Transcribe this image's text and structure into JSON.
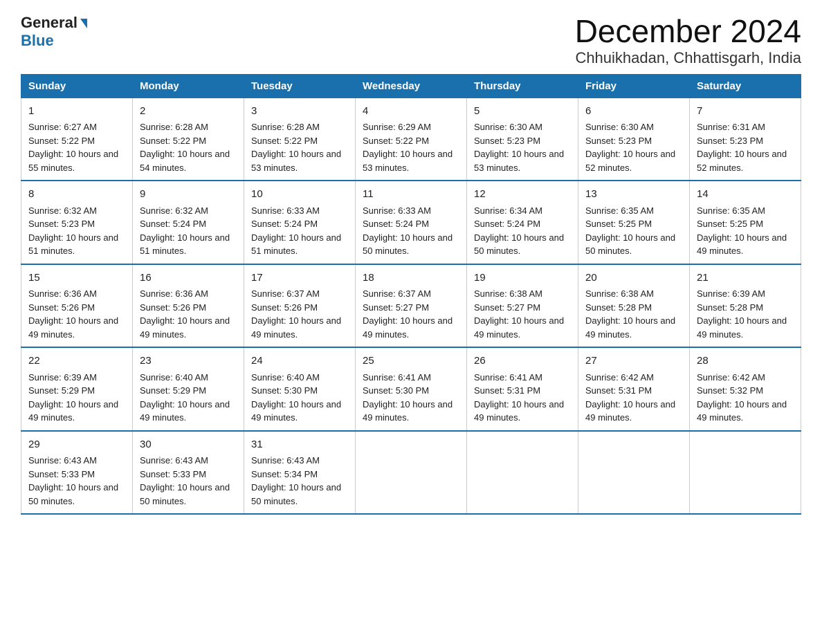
{
  "logo": {
    "general": "General",
    "blue": "Blue"
  },
  "title": "December 2024",
  "subtitle": "Chhuikhadan, Chhattisgarh, India",
  "days_header": [
    "Sunday",
    "Monday",
    "Tuesday",
    "Wednesday",
    "Thursday",
    "Friday",
    "Saturday"
  ],
  "weeks": [
    [
      {
        "day": "1",
        "sunrise": "6:27 AM",
        "sunset": "5:22 PM",
        "daylight": "10 hours and 55 minutes."
      },
      {
        "day": "2",
        "sunrise": "6:28 AM",
        "sunset": "5:22 PM",
        "daylight": "10 hours and 54 minutes."
      },
      {
        "day": "3",
        "sunrise": "6:28 AM",
        "sunset": "5:22 PM",
        "daylight": "10 hours and 53 minutes."
      },
      {
        "day": "4",
        "sunrise": "6:29 AM",
        "sunset": "5:22 PM",
        "daylight": "10 hours and 53 minutes."
      },
      {
        "day": "5",
        "sunrise": "6:30 AM",
        "sunset": "5:23 PM",
        "daylight": "10 hours and 53 minutes."
      },
      {
        "day": "6",
        "sunrise": "6:30 AM",
        "sunset": "5:23 PM",
        "daylight": "10 hours and 52 minutes."
      },
      {
        "day": "7",
        "sunrise": "6:31 AM",
        "sunset": "5:23 PM",
        "daylight": "10 hours and 52 minutes."
      }
    ],
    [
      {
        "day": "8",
        "sunrise": "6:32 AM",
        "sunset": "5:23 PM",
        "daylight": "10 hours and 51 minutes."
      },
      {
        "day": "9",
        "sunrise": "6:32 AM",
        "sunset": "5:24 PM",
        "daylight": "10 hours and 51 minutes."
      },
      {
        "day": "10",
        "sunrise": "6:33 AM",
        "sunset": "5:24 PM",
        "daylight": "10 hours and 51 minutes."
      },
      {
        "day": "11",
        "sunrise": "6:33 AM",
        "sunset": "5:24 PM",
        "daylight": "10 hours and 50 minutes."
      },
      {
        "day": "12",
        "sunrise": "6:34 AM",
        "sunset": "5:24 PM",
        "daylight": "10 hours and 50 minutes."
      },
      {
        "day": "13",
        "sunrise": "6:35 AM",
        "sunset": "5:25 PM",
        "daylight": "10 hours and 50 minutes."
      },
      {
        "day": "14",
        "sunrise": "6:35 AM",
        "sunset": "5:25 PM",
        "daylight": "10 hours and 49 minutes."
      }
    ],
    [
      {
        "day": "15",
        "sunrise": "6:36 AM",
        "sunset": "5:26 PM",
        "daylight": "10 hours and 49 minutes."
      },
      {
        "day": "16",
        "sunrise": "6:36 AM",
        "sunset": "5:26 PM",
        "daylight": "10 hours and 49 minutes."
      },
      {
        "day": "17",
        "sunrise": "6:37 AM",
        "sunset": "5:26 PM",
        "daylight": "10 hours and 49 minutes."
      },
      {
        "day": "18",
        "sunrise": "6:37 AM",
        "sunset": "5:27 PM",
        "daylight": "10 hours and 49 minutes."
      },
      {
        "day": "19",
        "sunrise": "6:38 AM",
        "sunset": "5:27 PM",
        "daylight": "10 hours and 49 minutes."
      },
      {
        "day": "20",
        "sunrise": "6:38 AM",
        "sunset": "5:28 PM",
        "daylight": "10 hours and 49 minutes."
      },
      {
        "day": "21",
        "sunrise": "6:39 AM",
        "sunset": "5:28 PM",
        "daylight": "10 hours and 49 minutes."
      }
    ],
    [
      {
        "day": "22",
        "sunrise": "6:39 AM",
        "sunset": "5:29 PM",
        "daylight": "10 hours and 49 minutes."
      },
      {
        "day": "23",
        "sunrise": "6:40 AM",
        "sunset": "5:29 PM",
        "daylight": "10 hours and 49 minutes."
      },
      {
        "day": "24",
        "sunrise": "6:40 AM",
        "sunset": "5:30 PM",
        "daylight": "10 hours and 49 minutes."
      },
      {
        "day": "25",
        "sunrise": "6:41 AM",
        "sunset": "5:30 PM",
        "daylight": "10 hours and 49 minutes."
      },
      {
        "day": "26",
        "sunrise": "6:41 AM",
        "sunset": "5:31 PM",
        "daylight": "10 hours and 49 minutes."
      },
      {
        "day": "27",
        "sunrise": "6:42 AM",
        "sunset": "5:31 PM",
        "daylight": "10 hours and 49 minutes."
      },
      {
        "day": "28",
        "sunrise": "6:42 AM",
        "sunset": "5:32 PM",
        "daylight": "10 hours and 49 minutes."
      }
    ],
    [
      {
        "day": "29",
        "sunrise": "6:43 AM",
        "sunset": "5:33 PM",
        "daylight": "10 hours and 50 minutes."
      },
      {
        "day": "30",
        "sunrise": "6:43 AM",
        "sunset": "5:33 PM",
        "daylight": "10 hours and 50 minutes."
      },
      {
        "day": "31",
        "sunrise": "6:43 AM",
        "sunset": "5:34 PM",
        "daylight": "10 hours and 50 minutes."
      },
      null,
      null,
      null,
      null
    ]
  ]
}
